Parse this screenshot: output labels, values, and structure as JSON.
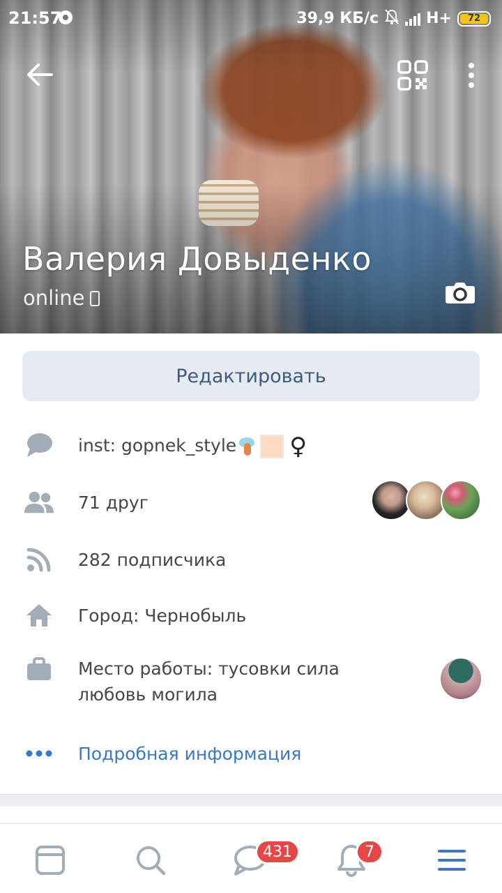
{
  "status_bar": {
    "time": "21:57",
    "network_speed": "39,9 КБ/с",
    "network_type": "H+",
    "battery": "72"
  },
  "profile": {
    "name": "Валерия Довыденко",
    "status": "online"
  },
  "actions": {
    "edit_label": "Редактировать"
  },
  "info": {
    "about_text": "inst: gopnek_style",
    "female_sign": "♀",
    "friends": "71 друг",
    "followers": "282 подписчика",
    "city": "Город: Чернобыль",
    "work_line1": "Место работы: тусовки сила",
    "work_line2": "любовь могила",
    "details_link": "Подробная информация"
  },
  "bottom_nav": {
    "messages_badge": "431",
    "notifications_badge": "7"
  },
  "colors": {
    "accent": "#3a78c3",
    "icon_gray": "#a3adb8",
    "badge_red": "#e64646",
    "edit_bg": "#e6ebf2",
    "edit_text": "#3f5a80"
  }
}
